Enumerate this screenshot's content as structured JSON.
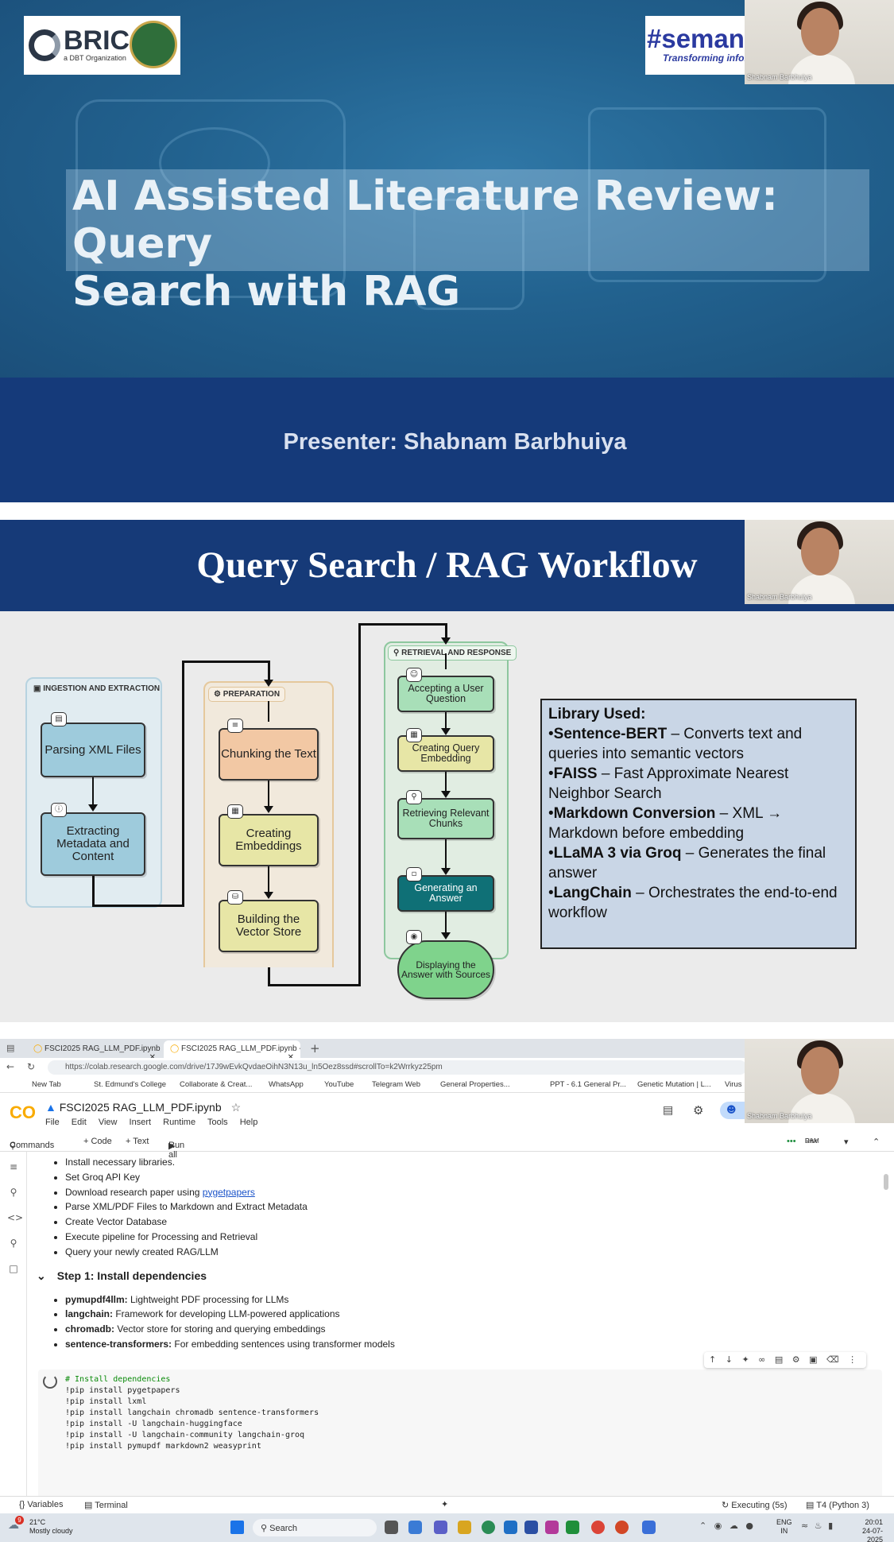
{
  "slide1": {
    "logo_left": {
      "brand": "BRIC",
      "subtitle": "a DBT Organization"
    },
    "logo_right": {
      "hashtag": "#seman",
      "tagline": "Transforming inforn"
    },
    "title_line1": "AI Assisted Literature Review: Query",
    "title_line2": "Search with RAG",
    "presenter": "Presenter: Shabnam Barbhuiya",
    "webcam_name": "Shabnam Barbhuiya"
  },
  "slide2": {
    "title": "Query Search / RAG Workflow",
    "webcam_name": "Shabnam Barbhuiya",
    "columns": [
      {
        "label": "INGESTION AND EXTRACTION",
        "nodes": [
          "Parsing XML Files",
          "Extracting Metadata and Content"
        ]
      },
      {
        "label": "PREPARATION",
        "nodes": [
          "Chunking the Text",
          "Creating Embeddings",
          "Building the Vector Store"
        ]
      },
      {
        "label": "RETRIEVAL AND RESPONSE",
        "nodes": [
          "Accepting a User Question",
          "Creating Query Embedding",
          "Retrieving Relevant Chunks",
          "Generating an Answer",
          "Displaying the Answer with Sources"
        ]
      }
    ],
    "library": {
      "heading": "Library Used:",
      "items": [
        {
          "name": "Sentence-BERT",
          "desc": " – Converts text and queries into semantic vectors"
        },
        {
          "name": "FAISS",
          "desc": " – Fast Approximate Nearest Neighbor Search"
        },
        {
          "name": "Markdown Conversion",
          "desc": " – XML → Markdown before embedding"
        },
        {
          "name": "LLaMA 3 via Groq",
          "desc": " – Generates the final answer"
        },
        {
          "name": "LangChain",
          "desc": " – Orchestrates the end-to-end workflow"
        }
      ]
    },
    "colors": {
      "ingestion_node": "#9ecbdc",
      "prep_node_first": "#f2c8a4",
      "prep_node": "#e7e6a6",
      "retr_node": "#a8dfb8",
      "retr_dark": "#0f7076"
    }
  },
  "colab": {
    "tabs": [
      "FSCI2025 RAG_LLM_PDF.ipynb - C",
      "FSCI2025 RAG_LLM_PDF.ipynb - C"
    ],
    "url": "https://colab.research.google.com/drive/17J9wEvkQvdaeOihN3N13u_ln5Oez8ssd#scrollTo=k2Wrrkyz25pm",
    "bookmarks": [
      "New Tab",
      "St. Edmund's College",
      "Collaborate & Creat...",
      "WhatsApp",
      "YouTube",
      "Telegram Web",
      "General Properties...",
      "PPT - 6.1 General Pr...",
      "Genetic Mutation | L...",
      "Virus"
    ],
    "notebook_name": "FSCI2025 RAG_LLM_PDF.ipynb",
    "menu": [
      "File",
      "Edit",
      "View",
      "Insert",
      "Runtime",
      "Tools",
      "Help"
    ],
    "toolbar": {
      "commands": "Commands",
      "code": "+ Code",
      "text": "+ Text",
      "run_all": "Run all",
      "ram": "RAM",
      "disk": "Disk"
    },
    "workflow_items": [
      "Install necessary libraries.",
      "Set Groq API Key",
      "Download research paper using ",
      "Parse XML/PDF Files to Markdown and Extract Metadata",
      "Create Vector Database",
      "Execute pipeline for Processing and Retrieval",
      "Query your newly created RAG/LLM"
    ],
    "link_text": "pygetpapers",
    "step1_heading": "Step 1: Install dependencies",
    "deps": [
      {
        "name": "pymupdf4llm:",
        "desc": " Lightweight PDF processing for LLMs"
      },
      {
        "name": "langchain:",
        "desc": " Framework for developing LLM-powered applications"
      },
      {
        "name": "chromadb:",
        "desc": " Vector store for storing and querying embeddings"
      },
      {
        "name": "sentence-transformers:",
        "desc": " For embedding sentences using transformer models"
      }
    ],
    "code_comment": "# Install dependencies",
    "code_lines": [
      "!pip install pygetpapers",
      "!pip install lxml",
      "!pip install langchain chromadb sentence-transformers",
      "!pip install -U langchain-huggingface",
      "!pip install -U langchain-community langchain-groq",
      "!pip install pymupdf markdown2 weasyprint"
    ],
    "status": {
      "variables": "Variables",
      "terminal": "Terminal",
      "executing": "Executing (5s)",
      "runtime": "T4 (Python 3)"
    },
    "webcam_name": "Shabnam Barbhuiya"
  },
  "taskbar": {
    "weather_temp": "21°C",
    "weather_desc": "Mostly cloudy",
    "search": "Search",
    "lang1": "ENG",
    "lang2": "IN",
    "time": "20:01",
    "date": "24-07-2025",
    "badge": "9"
  }
}
